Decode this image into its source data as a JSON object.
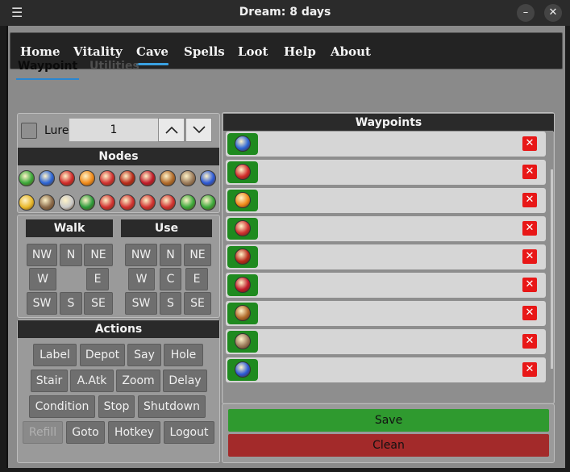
{
  "window": {
    "title": "Dream: 8 days",
    "menu_icon": "hamburger-icon"
  },
  "nav": [
    "Home",
    "Vitality",
    "Cave",
    "Spells",
    "Loot",
    "Help",
    "About"
  ],
  "subtabs": [
    "Waypoint",
    "Utilities"
  ],
  "lure": {
    "label": "Lure",
    "value": "1"
  },
  "nodes": {
    "header": "Nodes",
    "icons": [
      {
        "name": "check-node",
        "color": "#3aa83a"
      },
      {
        "name": "question-node",
        "color": "#2a64d6"
      },
      {
        "name": "exclamation-node",
        "color": "#d02a2a"
      },
      {
        "name": "star-node",
        "color": "#f08a1a"
      },
      {
        "name": "x-node",
        "color": "#d03030"
      },
      {
        "name": "plus-node",
        "color": "#b82a1a"
      },
      {
        "name": "lips-node",
        "color": "#c01a2a"
      },
      {
        "name": "sword-node",
        "color": "#b06a2a"
      },
      {
        "name": "no-entry-node",
        "color": "#9a7a5a"
      },
      {
        "name": "flag-node",
        "color": "#2a58d6"
      },
      {
        "name": "lock-node",
        "color": "#e8b82a"
      },
      {
        "name": "swords-node",
        "color": "#8a6a4a"
      },
      {
        "name": "shield-node",
        "color": "#c8c8c8"
      },
      {
        "name": "dollar-node",
        "color": "#2a9a3a"
      },
      {
        "name": "arrow-up-node",
        "color": "#d03030"
      },
      {
        "name": "arrow-down-node",
        "color": "#d03030"
      },
      {
        "name": "arrow-right-node",
        "color": "#d03030"
      },
      {
        "name": "arrow-left-node",
        "color": "#d03030"
      },
      {
        "name": "triangle-up-node",
        "color": "#3aa83a"
      },
      {
        "name": "triangle-down-node",
        "color": "#3aa83a"
      }
    ]
  },
  "walk": {
    "header": "Walk",
    "buttons": [
      "NW",
      "N",
      "NE",
      "W",
      "E",
      "SW",
      "S",
      "SE"
    ]
  },
  "use": {
    "header": "Use",
    "buttons": [
      "NW",
      "N",
      "NE",
      "W",
      "C",
      "E",
      "SW",
      "S",
      "SE"
    ]
  },
  "actions": {
    "header": "Actions",
    "rows": [
      [
        "Label",
        "Depot",
        "Say",
        "Hole"
      ],
      [
        "Stair",
        "A.Atk",
        "Zoom",
        "Delay"
      ],
      [
        "Condition",
        "Stop",
        "Shutdown"
      ],
      [
        "Refill",
        "Goto",
        "Hotkey",
        "Logout"
      ]
    ]
  },
  "waypoints": {
    "header": "Waypoints",
    "items": [
      {
        "icon": "question-icon",
        "color": "#2a64d6"
      },
      {
        "icon": "exclamation-icon",
        "color": "#d02a2a"
      },
      {
        "icon": "star-icon",
        "color": "#f08a1a"
      },
      {
        "icon": "x-icon",
        "color": "#d03030"
      },
      {
        "icon": "plus-icon",
        "color": "#b82a1a"
      },
      {
        "icon": "lips-icon",
        "color": "#c01a2a"
      },
      {
        "icon": "sword-icon",
        "color": "#b06a2a"
      },
      {
        "icon": "no-entry-icon",
        "color": "#9a7a5a"
      },
      {
        "icon": "flag-icon",
        "color": "#2a58d6"
      }
    ],
    "delete_glyph": "✕"
  },
  "buttons": {
    "save": "Save",
    "clean": "Clean"
  }
}
